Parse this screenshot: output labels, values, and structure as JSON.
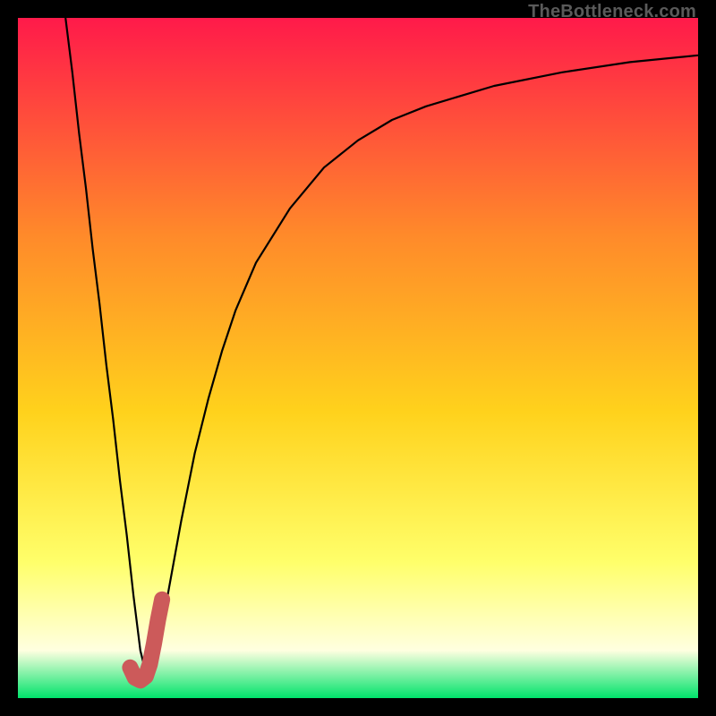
{
  "watermark": "TheBottleneck.com",
  "gradient": {
    "top": "#ff1a4a",
    "upper_mid": "#ff8a2a",
    "mid": "#ffd21c",
    "lower_mid": "#ffff6a",
    "pale": "#ffffe0",
    "bottom": "#00e36b"
  },
  "chart_data": {
    "type": "line",
    "title": "",
    "xlabel": "",
    "ylabel": "",
    "xlim": [
      0,
      100
    ],
    "ylim": [
      0,
      100
    ],
    "grid": false,
    "series": [
      {
        "name": "black-curve",
        "color": "#000000",
        "stroke_width": 2.2,
        "x": [
          7,
          8,
          9,
          10,
          11,
          12,
          13,
          14,
          15,
          16,
          17,
          18,
          19,
          20,
          21,
          22,
          24,
          26,
          28,
          30,
          32,
          35,
          40,
          45,
          50,
          55,
          60,
          70,
          80,
          90,
          100
        ],
        "values": [
          100,
          92,
          83,
          75,
          66,
          58,
          49,
          41,
          32,
          24,
          15,
          7,
          3,
          4,
          9,
          15,
          26,
          36,
          44,
          51,
          57,
          64,
          72,
          78,
          82,
          85,
          87,
          90,
          92,
          93.5,
          94.5
        ]
      },
      {
        "name": "j-marker",
        "color": "#cc5a5a",
        "stroke_width": 18,
        "linecap": "round",
        "x": [
          16.5,
          17.2,
          18.0,
          18.8,
          19.4,
          20.0,
          20.6,
          21.2
        ],
        "values": [
          4.5,
          3.0,
          2.6,
          3.2,
          5.0,
          8.0,
          11.5,
          14.5
        ]
      }
    ]
  }
}
